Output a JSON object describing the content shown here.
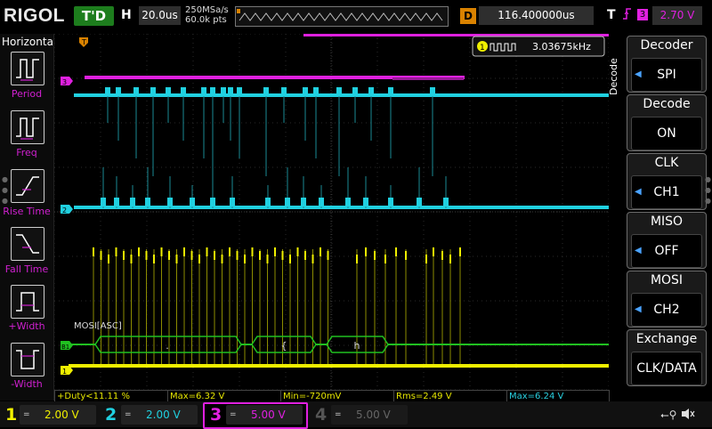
{
  "brand": "RIGOL",
  "run_state": "T'D",
  "horizontal": {
    "label": "H",
    "scale": "20.0us",
    "sample_rate": "250MSa/s",
    "memory": "60.0k pts"
  },
  "delay": {
    "label": "D",
    "value": "116.400000us"
  },
  "trigger": {
    "label": "T",
    "source": "3",
    "level": "2.70 V"
  },
  "left_menu": {
    "title": "Horizontal",
    "items": [
      {
        "label": "Period",
        "icon": "period-icon"
      },
      {
        "label": "Freq",
        "icon": "freq-icon"
      },
      {
        "label": "Rise Time",
        "icon": "rise-time-icon"
      },
      {
        "label": "Fall Time",
        "icon": "fall-time-icon"
      },
      {
        "label": "+Width",
        "icon": "pos-width-icon"
      },
      {
        "label": "-Width",
        "icon": "neg-width-icon"
      }
    ]
  },
  "freq_readout": {
    "channel": "1",
    "value": "3.03675kHz"
  },
  "waveform_labels": {
    "ch3": "3",
    "ch2": "2",
    "bus": "B1",
    "ch1": "1",
    "trigger_pos": "T",
    "decode_title": "MOSI[ASC]",
    "decode_values": [
      ".",
      "{",
      "h"
    ]
  },
  "right_menu": {
    "side_title": "Decode",
    "items": [
      {
        "title": "Decoder",
        "value": "SPI"
      },
      {
        "title": "Decode",
        "value": "ON"
      },
      {
        "title": "CLK",
        "value": "CH1"
      },
      {
        "title": "MISO",
        "value": "OFF"
      },
      {
        "title": "MOSI",
        "value": "CH2"
      },
      {
        "title": "Exchange",
        "value": "CLK/DATA"
      }
    ]
  },
  "measurements": [
    {
      "text": "+Duty<11.11 %",
      "color": "#e6e600"
    },
    {
      "text": "Max=6.32 V",
      "color": "#e6e600"
    },
    {
      "text": "Min=-720mV",
      "color": "#e6e600"
    },
    {
      "text": "Rms=2.49 V",
      "color": "#e6e600"
    },
    {
      "text": "Max=6.24 V",
      "color": "#29d0e0"
    }
  ],
  "channels": [
    {
      "num": "1",
      "coupling": "=",
      "scale": "2.00 V",
      "color": "#f0f000"
    },
    {
      "num": "2",
      "coupling": "=",
      "scale": "2.00 V",
      "color": "#20d0e0"
    },
    {
      "num": "3",
      "coupling": "=",
      "scale": "5.00 V",
      "color": "#e020e0"
    },
    {
      "num": "4",
      "coupling": "=",
      "scale": "5.00 V",
      "color": "#555555"
    }
  ],
  "colors": {
    "ch1": "#f0f000",
    "ch2": "#20d0e0",
    "ch3": "#e020e0",
    "bus": "#20c020",
    "accent": "#d98200"
  }
}
